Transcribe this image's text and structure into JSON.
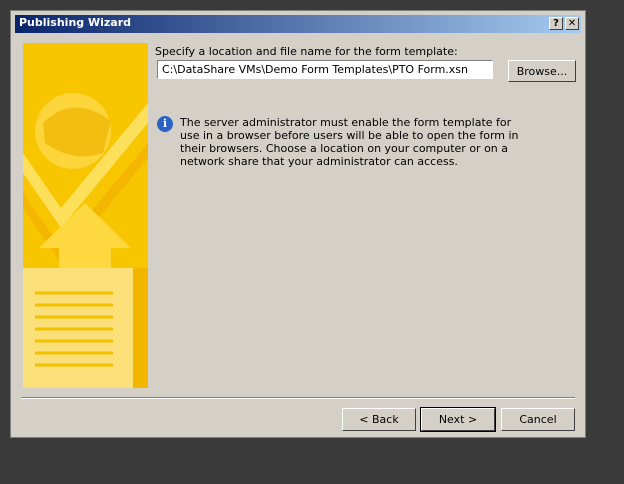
{
  "window": {
    "title": "Publishing Wizard",
    "help_glyph": "?",
    "close_glyph": "✕"
  },
  "form": {
    "location_label": "Specify a location and file name for the form template:",
    "path_value": "C:\\DataShare VMs\\Demo Form Templates\\PTO Form.xsn",
    "browse_label": "Browse..."
  },
  "info": {
    "icon": "info-icon",
    "text": "The server administrator must enable the form template for use in a browser before users will be able to open the form in their browsers. Choose a location on your computer or on a network share that your administrator can access."
  },
  "buttons": {
    "back": "< Back",
    "next": "Next >",
    "cancel": "Cancel"
  },
  "colors": {
    "banner_yellow": "#f7c600",
    "title_blue": "#0a246a"
  }
}
